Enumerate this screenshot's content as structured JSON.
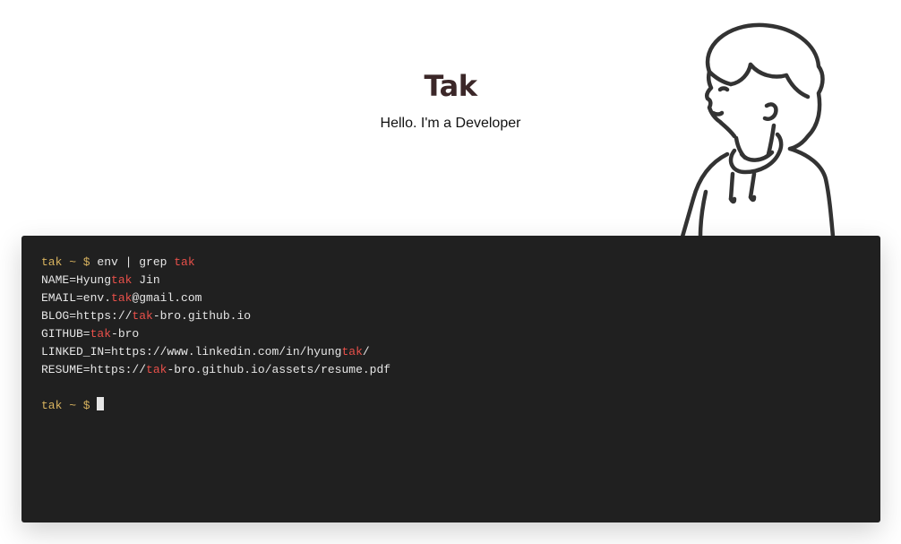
{
  "header": {
    "title": "Tak",
    "subtitle": "Hello. I'm a Developer"
  },
  "avatar": {
    "icon": "boy-sketch-illustration"
  },
  "colors": {
    "title": "#3b2728",
    "terminal_bg": "#202020",
    "prompt": "#d8b35f",
    "highlight": "#e8504a",
    "text": "#e6e6e6"
  },
  "terminal": {
    "command": {
      "prompt": "tak ~ $",
      "pre": " env | grep ",
      "hl": "tak",
      "post": ""
    },
    "output": [
      {
        "pre": "NAME=Hyung",
        "hl": "tak",
        "post": " Jin"
      },
      {
        "pre": "EMAIL=env.",
        "hl": "tak",
        "post": "@gmail.com"
      },
      {
        "pre": "BLOG=https://",
        "hl": "tak",
        "post": "-bro.github.io"
      },
      {
        "pre": "GITHUB=",
        "hl": "tak",
        "post": "-bro"
      },
      {
        "pre": "LINKED_IN=https://www.linkedin.com/in/hyung",
        "hl": "tak",
        "post": "/"
      },
      {
        "pre": "RESUME=https://",
        "hl": "tak",
        "post": "-bro.github.io/assets/resume.pdf"
      }
    ],
    "current_prompt": "tak ~ $"
  }
}
